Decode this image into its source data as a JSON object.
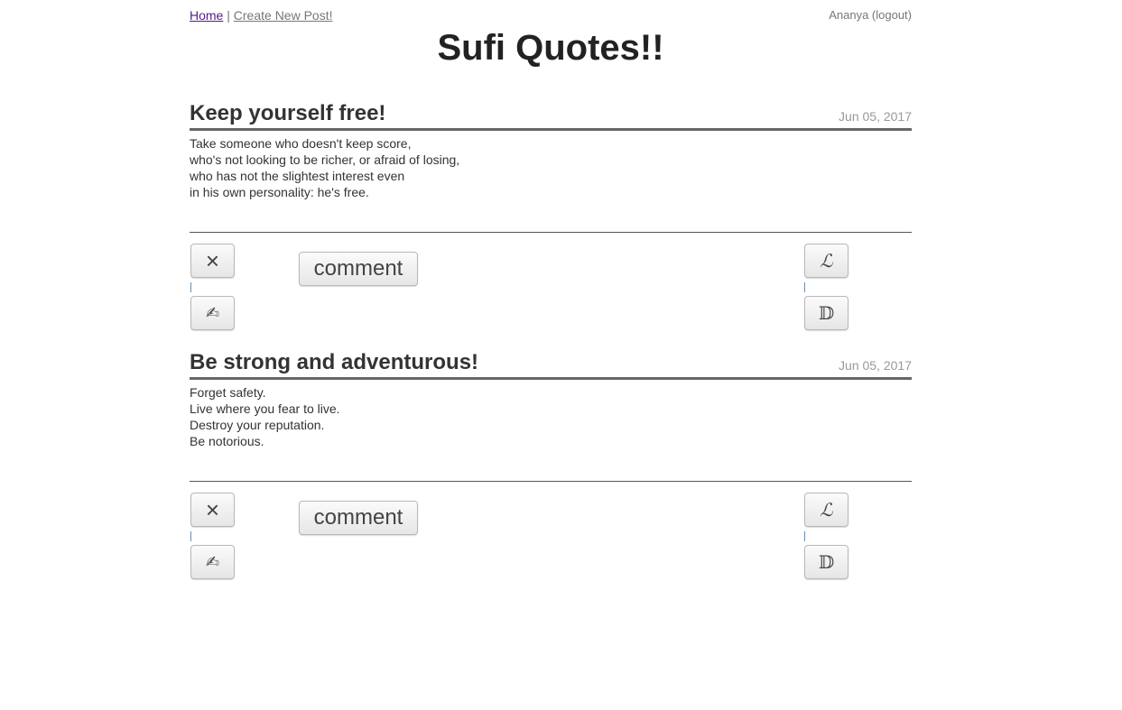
{
  "nav": {
    "home": "Home",
    "separator": "|",
    "create": "Create New Post!"
  },
  "user": {
    "name": "Ananya",
    "logout": "(logout)"
  },
  "site": {
    "title": "Sufi Quotes!!"
  },
  "icons": {
    "delete": "×",
    "edit": "✍",
    "like": "ℒ",
    "dislike": "𝔻"
  },
  "posts": [
    {
      "title": "Keep yourself free!",
      "date": "Jun 05, 2017",
      "lines": [
        "Take someone who doesn't keep score,",
        "who's not looking to be richer, or afraid of losing,",
        "who has not the slightest interest even",
        "in his own personality: he's free."
      ],
      "comment_label": "comment"
    },
    {
      "title": "Be strong and adventurous!",
      "date": "Jun 05, 2017",
      "lines": [
        "Forget safety.",
        "Live where you fear to live.",
        "Destroy your reputation.",
        "Be notorious."
      ],
      "comment_label": "comment"
    }
  ]
}
